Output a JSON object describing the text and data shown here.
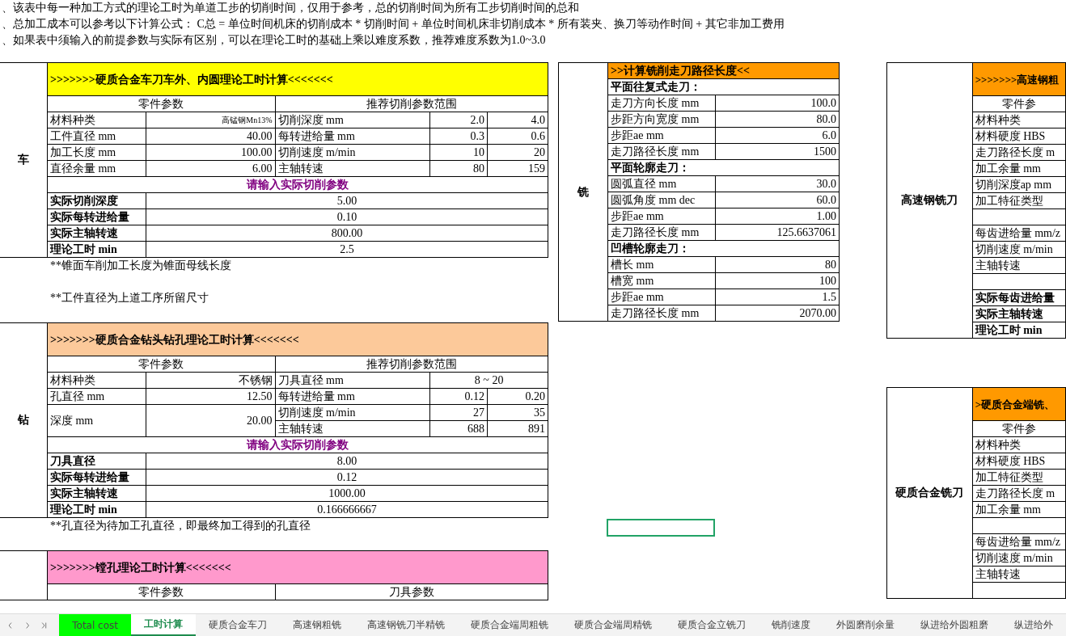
{
  "notes": [
    "、该表中每一种加工方式的理论工时为单道工步的切削时间，仅用于参考，总的切削时间为所有工步切削时间的总和",
    "、总加工成本可以参考以下计算公式： C总 = 单位时间机床的切削成本 * 切削时间 + 单位时间机床非切削成本 * 所有装夹、换刀等动作时间 + 其它非加工费用",
    "、如果表中须输入的前提参数与实际有区别，可以在理论工时的基础上乘以难度系数，推荐难度系数为1.0~3.0"
  ],
  "columns": [
    {
      "kind": "left",
      "blocks": [
        {
          "kind": "table",
          "side": "车",
          "title": ">>>>>>>硬质合金车刀车外、内圆理论工时计算<<<<<<<",
          "color": "#ffff00",
          "rows": [
            [
              {
                "text": "零件参数",
                "colspan": 2,
                "kind": "header"
              },
              {
                "text": "推荐切削参数范围",
                "colspan": 3,
                "kind": "header"
              }
            ],
            [
              {
                "text": "材料种类"
              },
              {
                "text": "高锰钢Mn13%",
                "kind": "small"
              },
              {
                "text": "切削深度 mm"
              },
              {
                "text": "2.0",
                "kind": "value"
              },
              {
                "text": "4.0",
                "kind": "value"
              }
            ],
            [
              {
                "text": "工件直径 mm"
              },
              {
                "text": "40.00",
                "kind": "value"
              },
              {
                "text": "每转进给量 mm"
              },
              {
                "text": "0.3",
                "kind": "value"
              },
              {
                "text": "0.6",
                "kind": "value"
              }
            ],
            [
              {
                "text": "加工长度 mm"
              },
              {
                "text": "100.00",
                "kind": "value"
              },
              {
                "text": "切削速度 m/min"
              },
              {
                "text": "10",
                "kind": "value"
              },
              {
                "text": "20",
                "kind": "value"
              }
            ],
            [
              {
                "text": "直径余量 mm"
              },
              {
                "text": "6.00",
                "kind": "value"
              },
              {
                "text": "主轴转速"
              },
              {
                "text": "80",
                "kind": "value"
              },
              {
                "text": "159",
                "kind": "value"
              }
            ],
            [
              {
                "text": "请输入实际切削参数",
                "colspan": 5,
                "kind": "prompt"
              }
            ],
            [
              {
                "text": "实际切削深度",
                "kind": "bold"
              },
              {
                "text": "5.00",
                "colspan": 4,
                "kind": "center"
              }
            ],
            [
              {
                "text": "实际每转进给量",
                "kind": "bold"
              },
              {
                "text": "0.10",
                "colspan": 4,
                "kind": "center"
              }
            ],
            [
              {
                "text": "实际主轴转速",
                "kind": "bold"
              },
              {
                "text": "800.00",
                "colspan": 4,
                "kind": "center"
              }
            ],
            [
              {
                "text": "理论工时 min",
                "kind": "bold"
              },
              {
                "text": "2.5",
                "colspan": 4,
                "kind": "center"
              }
            ]
          ]
        },
        {
          "kind": "notes",
          "lines": [
            "**锥面车削加工长度为锥面母线长度",
            "**工件直径为上道工序所留尺寸"
          ]
        },
        {
          "kind": "table",
          "side": "钻",
          "title": ">>>>>>>硬质合金钻头钻孔理论工时计算<<<<<<<",
          "color": "#fcc99a",
          "rows": [
            [
              {
                "text": "零件参数",
                "colspan": 2,
                "kind": "header"
              },
              {
                "text": "推荐切削参数范围",
                "colspan": 3,
                "kind": "header"
              }
            ],
            [
              {
                "text": "材料种类"
              },
              {
                "text": "不锈钢",
                "kind": "value"
              },
              {
                "text": "刀具直径 mm"
              },
              {
                "text": "8 ~ 20",
                "colspan": 2,
                "kind": "center"
              }
            ],
            [
              {
                "text": "孔直径 mm"
              },
              {
                "text": "12.50",
                "kind": "value"
              },
              {
                "text": "每转进给量 mm"
              },
              {
                "text": "0.12",
                "kind": "value"
              },
              {
                "text": "0.20",
                "kind": "value"
              }
            ],
            [
              {
                "text": "深度 mm",
                "rowspan": 2
              },
              {
                "text": "20.00",
                "rowspan": 2,
                "kind": "value"
              },
              {
                "text": "切削速度 m/min"
              },
              {
                "text": "27",
                "kind": "value"
              },
              {
                "text": "35",
                "kind": "value"
              }
            ],
            [
              {
                "text": "主轴转速"
              },
              {
                "text": "688",
                "kind": "value"
              },
              {
                "text": "891",
                "kind": "value"
              }
            ],
            [
              {
                "text": "请输入实际切削参数",
                "colspan": 5,
                "kind": "prompt"
              }
            ],
            [
              {
                "text": "刀具直径",
                "kind": "bold"
              },
              {
                "text": "8.00",
                "colspan": 4,
                "kind": "center"
              }
            ],
            [
              {
                "text": "实际每转进给量",
                "kind": "bold"
              },
              {
                "text": "0.12",
                "colspan": 4,
                "kind": "center"
              }
            ],
            [
              {
                "text": "实际主轴转速",
                "kind": "bold"
              },
              {
                "text": "1000.00",
                "colspan": 4,
                "kind": "center"
              }
            ],
            [
              {
                "text": "理论工时 min",
                "kind": "bold"
              },
              {
                "text": "0.166666667",
                "colspan": 4,
                "kind": "center"
              }
            ]
          ]
        },
        {
          "kind": "notes",
          "lines": [
            "**孔直径为待加工孔直径，即最终加工得到的孔直径"
          ]
        },
        {
          "kind": "table",
          "title": ">>>>>>>镗孔理论工时计算<<<<<<<",
          "color": "#ff99cc",
          "rows": [
            [
              {
                "text": "零件参数",
                "colspan": 2,
                "kind": "header"
              },
              {
                "text": "刀具参数",
                "colspan": 3,
                "kind": "header"
              }
            ]
          ]
        }
      ]
    },
    {
      "kind": "middle",
      "blocks": [
        {
          "kind": "table",
          "side": "铣",
          "title": ">>计算铣削走刀路径长度<<",
          "color": "#ff9900",
          "rows": [
            [
              {
                "text": "平面往复式走刀：",
                "colspan": 2,
                "kind": "bold"
              }
            ],
            [
              {
                "text": "走刀方向长度 mm"
              },
              {
                "text": "100.0",
                "kind": "value"
              }
            ],
            [
              {
                "text": "步距方向宽度 mm"
              },
              {
                "text": "80.0",
                "kind": "value"
              }
            ],
            [
              {
                "text": "步距ae mm"
              },
              {
                "text": "6.0",
                "kind": "value"
              }
            ],
            [
              {
                "text": "走刀路径长度 mm"
              },
              {
                "text": "1500",
                "kind": "value"
              }
            ],
            [
              {
                "text": "平面轮廓走刀：",
                "colspan": 2,
                "kind": "bold"
              }
            ],
            [
              {
                "text": "圆弧直径 mm"
              },
              {
                "text": "30.0",
                "kind": "value"
              }
            ],
            [
              {
                "text": "圆弧角度 mm dec"
              },
              {
                "text": "60.0",
                "kind": "value"
              }
            ],
            [
              {
                "text": "步距ae mm"
              },
              {
                "text": "1.00",
                "kind": "value"
              }
            ],
            [
              {
                "text": "走刀路径长度 mm"
              },
              {
                "text": "125.6637061",
                "kind": "value"
              }
            ],
            [
              {
                "text": "凹槽轮廓走刀：",
                "colspan": 2,
                "kind": "bold"
              }
            ],
            [
              {
                "text": "槽长  mm"
              },
              {
                "text": "80",
                "kind": "value"
              }
            ],
            [
              {
                "text": "槽宽  mm"
              },
              {
                "text": "100",
                "kind": "value"
              }
            ],
            [
              {
                "text": "步距ae mm"
              },
              {
                "text": "1.5",
                "kind": "value"
              }
            ],
            [
              {
                "text": "走刀路径长度 mm"
              },
              {
                "text": "2070.00",
                "kind": "value"
              }
            ]
          ]
        },
        {
          "kind": "cursor"
        }
      ]
    },
    {
      "kind": "right",
      "blocks": [
        {
          "kind": "table",
          "side": "高速钢铣刀",
          "title": ">>>>>>>高速钢粗",
          "color": "#ff9900",
          "rows": [
            [
              {
                "text": "零件参",
                "kind": "header"
              }
            ],
            [
              {
                "text": "材料种类"
              }
            ],
            [
              {
                "text": "材料硬度 HBS"
              }
            ],
            [
              {
                "text": "走刀路径长度 m"
              }
            ],
            [
              {
                "text": "加工余量 mm"
              }
            ],
            [
              {
                "text": "切削深度ap mm"
              }
            ],
            [
              {
                "text": "加工特征类型"
              }
            ],
            [
              {
                "kind": "blank"
              }
            ],
            [
              {
                "text": "每齿进给量 mm/z"
              }
            ],
            [
              {
                "text": "切削速度 m/min"
              }
            ],
            [
              {
                "text": "主轴转速"
              }
            ],
            [
              {
                "kind": "blank"
              }
            ],
            [
              {
                "text": "实际每齿进给量",
                "kind": "bold"
              }
            ],
            [
              {
                "text": "实际主轴转速",
                "kind": "bold"
              }
            ],
            [
              {
                "text": "理论工时 min",
                "kind": "bold"
              }
            ]
          ]
        },
        {
          "kind": "table",
          "side": "硬质合金铣刀",
          "title": ">硬质合金端铣、",
          "color": "#ff9900",
          "rows": [
            [
              {
                "text": "零件参",
                "kind": "header"
              }
            ],
            [
              {
                "text": "材料种类"
              }
            ],
            [
              {
                "text": "材料硬度 HBS"
              }
            ],
            [
              {
                "text": "加工特征类型"
              }
            ],
            [
              {
                "text": "走刀路径长度 m"
              }
            ],
            [
              {
                "text": "加工余量 mm"
              }
            ],
            [
              {
                "kind": "blank"
              }
            ],
            [
              {
                "text": "每齿进给量 mm/z"
              }
            ],
            [
              {
                "text": "切削速度 m/min"
              }
            ],
            [
              {
                "text": "主轴转速"
              }
            ],
            [
              {
                "kind": "blank"
              }
            ]
          ]
        }
      ]
    }
  ],
  "sheet_tabs": [
    {
      "label": "Total cost",
      "selected": false,
      "color": "#00ff00"
    },
    {
      "label": "工时计算",
      "selected": true
    },
    {
      "label": "硬质合金车刀",
      "selected": false
    },
    {
      "label": "高速钢粗铣",
      "selected": false
    },
    {
      "label": "高速钢铣刀半精铣",
      "selected": false
    },
    {
      "label": "硬质合金端周粗铣",
      "selected": false
    },
    {
      "label": "硬质合金端周精铣",
      "selected": false
    },
    {
      "label": "硬质合金立铣刀",
      "selected": false
    },
    {
      "label": "铣削速度",
      "selected": false
    },
    {
      "label": "外圆磨削余量",
      "selected": false
    },
    {
      "label": "纵进给外圆粗磨",
      "selected": false
    },
    {
      "label": "纵进给外",
      "selected": false
    }
  ]
}
